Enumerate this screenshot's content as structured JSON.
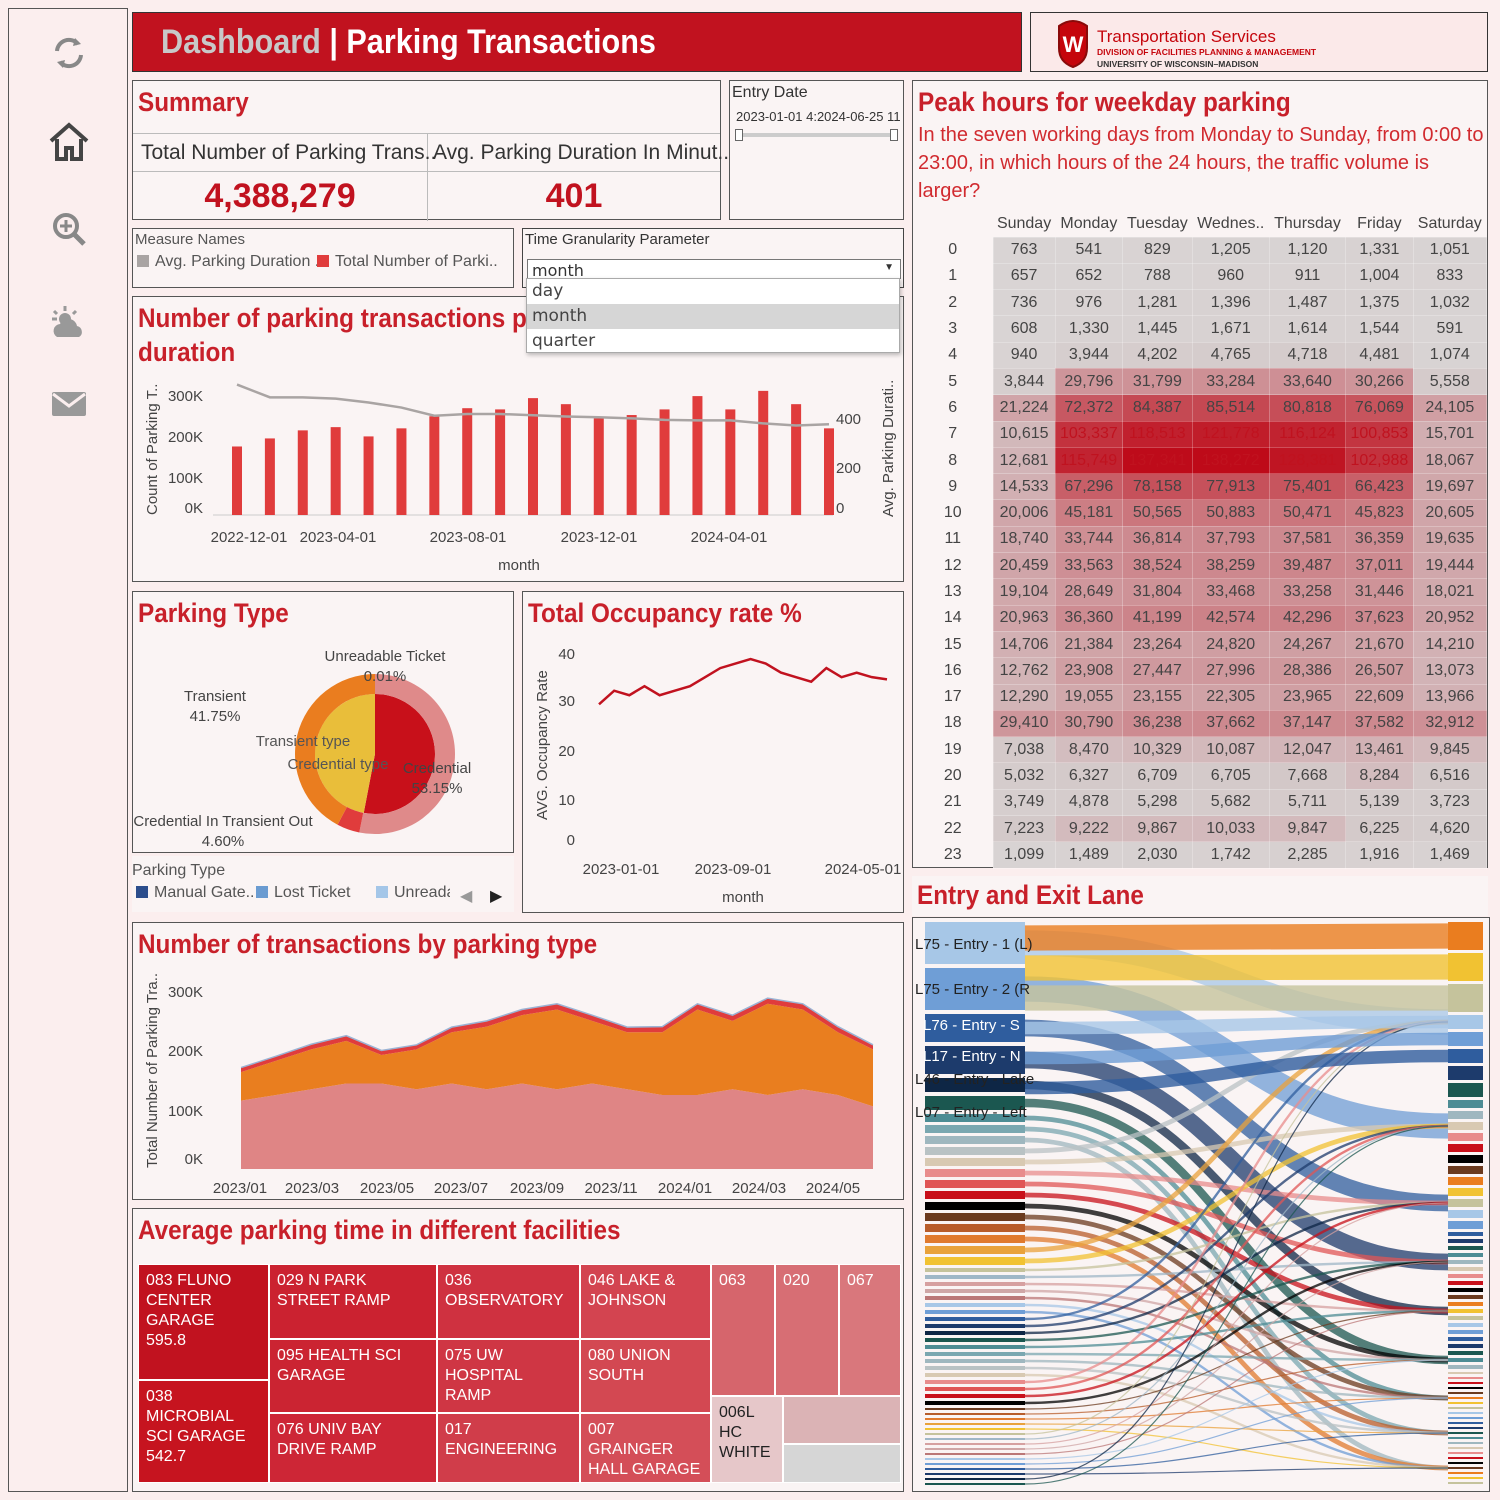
{
  "sidebar": {
    "icons": [
      "refresh-icon",
      "home-icon",
      "zoom-in-icon",
      "weather-icon",
      "mail-icon"
    ]
  },
  "header": {
    "title_a": "Dashboard",
    "title_sep": " | ",
    "title_b": "Parking Transactions"
  },
  "logo": {
    "line1": "Transportation Services",
    "line2": "DIVISION OF FACILITIES PLANNING & MANAGEMENT",
    "line3": "UNIVERSITY OF WISCONSIN–MADISON",
    "crest": "W"
  },
  "summary": {
    "title": "Summary",
    "col1": "Total Number of Parking Trans..",
    "col2": "Avg. Parking Duration In Minut..",
    "val1": "4,388,279",
    "val2": "401"
  },
  "entry_date": {
    "label": "Entry Date",
    "range": "2023-01-01 4:2024-06-25 11"
  },
  "measure_names": {
    "label": "Measure Names",
    "item1": "Avg. Parking Duration ..",
    "item2": "Total Number of Parki..",
    "color1": "#a9a4a3",
    "color2": "#e03c3c"
  },
  "granularity": {
    "label": "Time Granularity Parameter",
    "value": "month",
    "options": [
      "day",
      "month",
      "quarter"
    ]
  },
  "txn_chart": {
    "title_l1": "Number of parking transactions p",
    "title_l2": "duration",
    "ylabel": "Count of Parking T..",
    "y2label": "Avg. Parking Durati..",
    "xlabel": "month",
    "yticks": [
      "300K",
      "200K",
      "100K",
      "0K"
    ],
    "y2ticks": [
      "400",
      "200",
      "0"
    ],
    "xticks": [
      "2022-12-01",
      "2023-04-01",
      "2023-08-01",
      "2023-12-01",
      "2024-04-01"
    ]
  },
  "parking_type": {
    "title": "Parking Type",
    "inner1": "Transient type",
    "inner2": "Credential type",
    "labels": [
      {
        "name": "Unreadable Ticket",
        "pct": "0.01%"
      },
      {
        "name": "Transient",
        "pct": "41.75%"
      },
      {
        "name": "Credential",
        "pct": "53.15%"
      },
      {
        "name": "Credential In Transient Out",
        "pct": "4.60%"
      }
    ],
    "legend_label": "Parking Type",
    "legend": [
      "Manual Gate..",
      "Lost Ticket",
      "Unreada"
    ]
  },
  "occupancy": {
    "title": "Total Occupancy rate %",
    "ylabel": "AVG. Occupancy Rate",
    "xlabel": "month",
    "yticks": [
      "40",
      "30",
      "20",
      "10",
      "0"
    ],
    "xticks": [
      "2023-01-01",
      "2023-09-01",
      "2024-05-01"
    ]
  },
  "type_area": {
    "title": "Number of transactions by parking type",
    "ylabel": "Total Number of Parking Tra..",
    "yticks": [
      "300K",
      "200K",
      "100K",
      "0K"
    ],
    "xticks": [
      "2023/01",
      "2023/03",
      "2023/05",
      "2023/07",
      "2023/09",
      "2023/11",
      "2024/01",
      "2024/03",
      "2024/05"
    ]
  },
  "facilities": {
    "title": "Average parking time in different facilities",
    "tiles": [
      {
        "name": "083  FLUNO CENTER GARAGE",
        "value": "595.8"
      },
      {
        "name": "038  MICROBIAL SCI GARAGE",
        "value": "542.7"
      },
      {
        "name": "029  N PARK STREET RAMP",
        "value": ""
      },
      {
        "name": "095  HEALTH SCI GARAGE",
        "value": ""
      },
      {
        "name": "076  UNIV BAY DRIVE RAMP",
        "value": ""
      },
      {
        "name": "036 OBSERVATORY",
        "value": ""
      },
      {
        "name": "075  UW HOSPITAL RAMP",
        "value": ""
      },
      {
        "name": "017 ENGINEERING",
        "value": ""
      },
      {
        "name": "046  LAKE & JOHNSON",
        "value": ""
      },
      {
        "name": "080  UNION SOUTH",
        "value": ""
      },
      {
        "name": "007  GRAINGER HALL GARAGE",
        "value": ""
      },
      {
        "name": "063",
        "value": ""
      },
      {
        "name": "020",
        "value": ""
      },
      {
        "name": "067",
        "value": ""
      },
      {
        "name": "006L HC WHITE",
        "value": ""
      }
    ]
  },
  "peak": {
    "title": "Peak hours for weekday parking",
    "subtitle": "In the seven working days from Monday to Sunday, from 0:00 to 23:00, in which hours of the 24 hours, the traffic volume is larger?",
    "days": [
      "Sunday",
      "Monday",
      "Tuesday",
      "Wednes..",
      "Thursday",
      "Friday",
      "Saturday"
    ],
    "rows": [
      [
        "0",
        "763",
        "541",
        "829",
        "1,205",
        "1,120",
        "1,331",
        "1,051"
      ],
      [
        "1",
        "657",
        "652",
        "788",
        "960",
        "911",
        "1,004",
        "833"
      ],
      [
        "2",
        "736",
        "976",
        "1,281",
        "1,396",
        "1,487",
        "1,375",
        "1,032"
      ],
      [
        "3",
        "608",
        "1,330",
        "1,445",
        "1,671",
        "1,614",
        "1,544",
        "591"
      ],
      [
        "4",
        "940",
        "3,944",
        "4,202",
        "4,765",
        "4,718",
        "4,481",
        "1,074"
      ],
      [
        "5",
        "3,844",
        "29,796",
        "31,799",
        "33,284",
        "33,640",
        "30,266",
        "5,558"
      ],
      [
        "6",
        "21,224",
        "72,372",
        "84,387",
        "85,514",
        "80,818",
        "76,069",
        "24,105"
      ],
      [
        "7",
        "10,615",
        "103,337",
        "118,513",
        "121,778",
        "116,124",
        "100,853",
        "15,701"
      ],
      [
        "8",
        "12,681",
        "115,749",
        "137,341",
        "138,272",
        "128,381",
        "102,988",
        "18,067"
      ],
      [
        "9",
        "14,533",
        "67,296",
        "78,158",
        "77,913",
        "75,401",
        "66,423",
        "19,697"
      ],
      [
        "10",
        "20,006",
        "45,181",
        "50,565",
        "50,883",
        "50,471",
        "45,823",
        "20,605"
      ],
      [
        "11",
        "18,740",
        "33,744",
        "36,814",
        "37,793",
        "37,581",
        "36,359",
        "19,635"
      ],
      [
        "12",
        "20,459",
        "33,563",
        "38,524",
        "38,259",
        "39,487",
        "37,011",
        "19,444"
      ],
      [
        "13",
        "19,104",
        "28,649",
        "31,804",
        "33,468",
        "33,258",
        "31,446",
        "18,021"
      ],
      [
        "14",
        "20,963",
        "36,360",
        "41,199",
        "42,574",
        "42,296",
        "37,623",
        "20,952"
      ],
      [
        "15",
        "14,706",
        "21,384",
        "23,264",
        "24,820",
        "24,267",
        "21,670",
        "14,210"
      ],
      [
        "16",
        "12,762",
        "23,908",
        "27,447",
        "27,996",
        "28,386",
        "26,507",
        "13,073"
      ],
      [
        "17",
        "12,290",
        "19,055",
        "23,155",
        "22,305",
        "23,965",
        "22,609",
        "13,966"
      ],
      [
        "18",
        "29,410",
        "30,790",
        "36,238",
        "37,662",
        "37,147",
        "37,582",
        "32,912"
      ],
      [
        "19",
        "7,038",
        "8,470",
        "10,329",
        "10,087",
        "12,047",
        "13,461",
        "9,845"
      ],
      [
        "20",
        "5,032",
        "6,327",
        "6,709",
        "6,705",
        "7,668",
        "8,284",
        "6,516"
      ],
      [
        "21",
        "3,749",
        "4,878",
        "5,298",
        "5,682",
        "5,711",
        "5,139",
        "3,723"
      ],
      [
        "22",
        "7,223",
        "9,222",
        "9,867",
        "10,033",
        "9,847",
        "6,225",
        "4,620"
      ],
      [
        "23",
        "1,099",
        "1,489",
        "2,030",
        "1,742",
        "2,285",
        "1,916",
        "1,469"
      ]
    ]
  },
  "sankey": {
    "title": "Entry and Exit Lane",
    "labels": [
      "L75 - Entry - 1 (L)",
      "L75 - Entry - 2 (R",
      "L76 - Entry - S",
      "L17 - Entry - N",
      "L46 - Entry - Lake",
      "L07 - Entry - Left"
    ]
  },
  "chart_data": [
    {
      "type": "bar",
      "title": "Number of parking transactions p duration",
      "xlabel": "month",
      "ylabel": "Count of Parking T..",
      "y2label": "Avg. Parking Durati..",
      "series": [
        {
          "name": "Total Number of Parki..",
          "values": [
            170000,
            190000,
            210000,
            218000,
            195000,
            215000,
            245000,
            265000,
            262000,
            290000,
            275000,
            240000,
            248000,
            262000,
            295000,
            262000,
            308000,
            275000,
            215000
          ]
        },
        {
          "name": "Avg. Parking Duration ..",
          "values": [
            510,
            460,
            460,
            455,
            440,
            420,
            388,
            395,
            395,
            390,
            385,
            382,
            378,
            372,
            370,
            370,
            358,
            350,
            355
          ]
        }
      ],
      "ylim": [
        0,
        330000
      ],
      "y2lim": [
        0,
        520
      ]
    },
    {
      "type": "pie",
      "title": "Parking Type",
      "slices": [
        {
          "label": "Unreadable Ticket",
          "value": 0.01
        },
        {
          "label": "Transient",
          "value": 41.75
        },
        {
          "label": "Credential",
          "value": 53.15
        },
        {
          "label": "Credential In Transient Out",
          "value": 4.6
        }
      ]
    },
    {
      "type": "line",
      "title": "Total Occupancy rate %",
      "xlabel": "month",
      "ylabel": "AVG. Occupancy Rate",
      "values": [
        30,
        33,
        32,
        34,
        32,
        33,
        34,
        36,
        38,
        39,
        40,
        39,
        37,
        36,
        35,
        38,
        36,
        37,
        36,
        35.5
      ],
      "ylim": [
        0,
        42
      ]
    },
    {
      "type": "area",
      "title": "Number of transactions by parking type",
      "ylabel": "Total Number of Parking Tra..",
      "series": [
        {
          "name": "Credential",
          "values": [
            120000,
            130000,
            140000,
            150000,
            150000,
            140000,
            150000,
            140000,
            150000,
            140000,
            150000,
            140000,
            130000,
            130000,
            140000,
            130000,
            140000,
            130000,
            110000
          ]
        },
        {
          "name": "Transient",
          "values": [
            50000,
            60000,
            70000,
            75000,
            50000,
            70000,
            90000,
            110000,
            120000,
            140000,
            110000,
            100000,
            110000,
            150000,
            120000,
            160000,
            140000,
            110000,
            100000
          ]
        },
        {
          "name": "Credential In Transient Out",
          "values": [
            8000,
            8000,
            9000,
            9000,
            8000,
            8000,
            9000,
            10000,
            10000,
            10000,
            10000,
            9000,
            10000,
            10000,
            10000,
            10000,
            10000,
            10000,
            8000
          ]
        }
      ],
      "ylim": [
        0,
        330000
      ]
    }
  ]
}
